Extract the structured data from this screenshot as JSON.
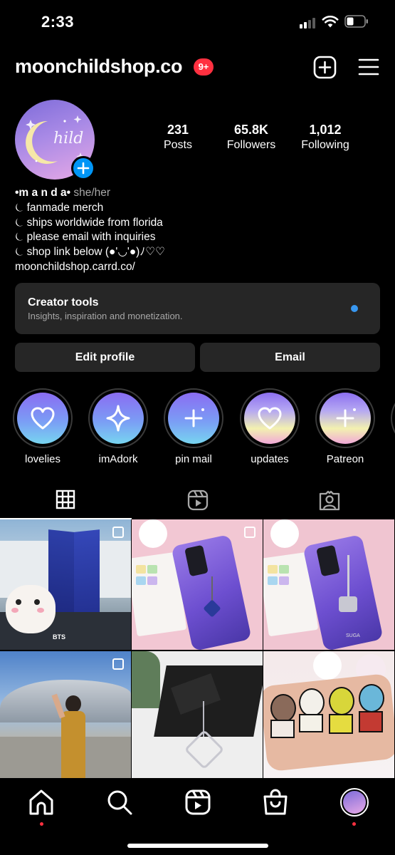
{
  "status_bar": {
    "time": "2:33"
  },
  "header": {
    "username": "moonchildshop.co",
    "notification_badge": "9+",
    "create_icon": "plus-square-icon",
    "menu_icon": "hamburger-menu-icon"
  },
  "profile": {
    "avatar_text": "hild",
    "stats": [
      {
        "value": "231",
        "label": "Posts"
      },
      {
        "value": "65.8K",
        "label": "Followers"
      },
      {
        "value": "1,012",
        "label": "Following"
      }
    ],
    "bio": {
      "name": "•m a n d a•",
      "pronouns": "she/her",
      "lines": [
        "⏾ fanmade merch",
        "⏾ ships worldwide from florida",
        "⏾ please email with inquiries",
        "⏾ shop link below (●'◡'●)ﾉ♡♡"
      ],
      "link": "moonchildshop.carrd.co/"
    }
  },
  "creator_tools": {
    "title": "Creator tools",
    "subtitle": "Insights, inspiration and monetization."
  },
  "buttons": {
    "edit_profile": "Edit profile",
    "email": "Email"
  },
  "highlights": [
    {
      "label": "lovelies",
      "icon": "heart-icon"
    },
    {
      "label": "imAdork",
      "icon": "sparkle-icon"
    },
    {
      "label": "pin mail",
      "icon": "plus-sparkle-icon"
    },
    {
      "label": "updates",
      "icon": "heart-icon"
    },
    {
      "label": "Patreon",
      "icon": "plus-sparkle-icon"
    }
  ],
  "tabs": [
    "grid-icon",
    "reels-icon",
    "tagged-icon"
  ],
  "grid": {
    "post_captions": [
      "BTS",
      "SUGA"
    ]
  },
  "bottom_nav": [
    "home-icon",
    "search-icon",
    "reels-icon",
    "shop-icon",
    "profile-avatar-icon"
  ],
  "colors": {
    "background": "#000000",
    "surface": "#262626",
    "accent_blue": "#0095f6",
    "badge_red": "#ff3040",
    "secondary_text": "#a8a8a8"
  }
}
